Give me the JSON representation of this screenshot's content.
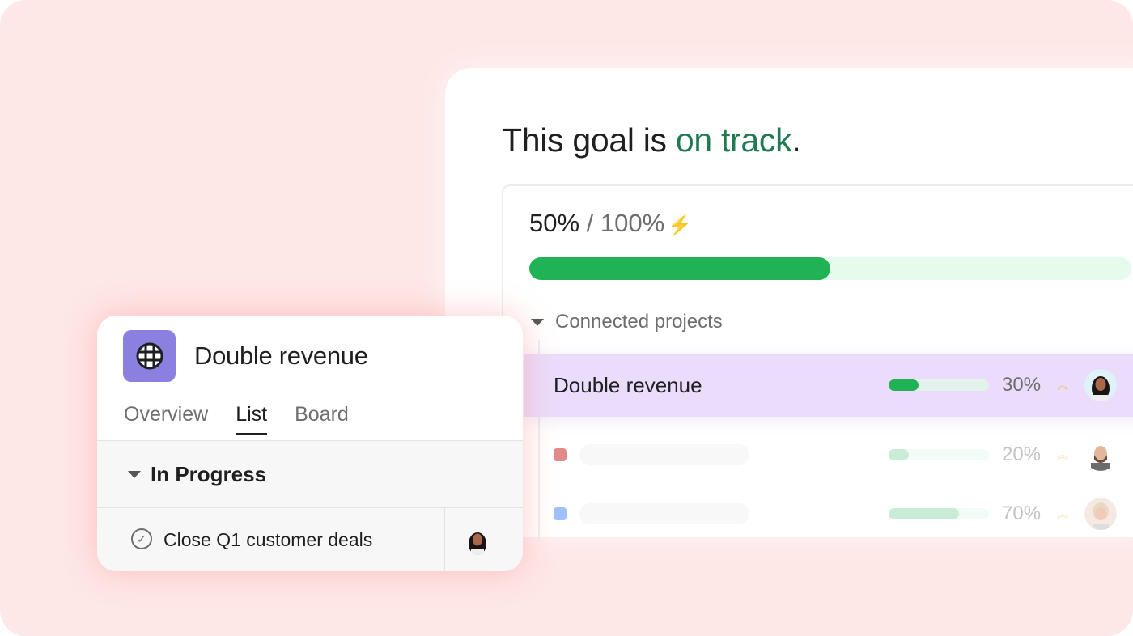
{
  "goal": {
    "title_prefix": "This goal is ",
    "status": "on track",
    "title_suffix": ".",
    "progress_current": "50%",
    "progress_separator": " / ",
    "progress_target": "100%",
    "progress_fraction": 0.5,
    "connected_label": "Connected projects",
    "projects": [
      {
        "name": "Double revenue",
        "percent": "30%",
        "fraction": 0.3,
        "highlighted": true
      },
      {
        "name": "",
        "percent": "20%",
        "fraction": 0.2,
        "color": "#e08a8a"
      },
      {
        "name": "",
        "percent": "70%",
        "fraction": 0.7,
        "color": "#9fc1fb"
      }
    ]
  },
  "project_card": {
    "title": "Double revenue",
    "icon": "globe-icon",
    "icon_color": "#8b7fe0",
    "tabs": [
      "Overview",
      "List",
      "Board"
    ],
    "active_tab": "List",
    "section": "In Progress",
    "task": "Close Q1 customer deals"
  },
  "colors": {
    "accent_green": "#22b256",
    "status_text": "#1f7a52",
    "highlight": "#ebdcfb",
    "background": "#fee7e7"
  }
}
